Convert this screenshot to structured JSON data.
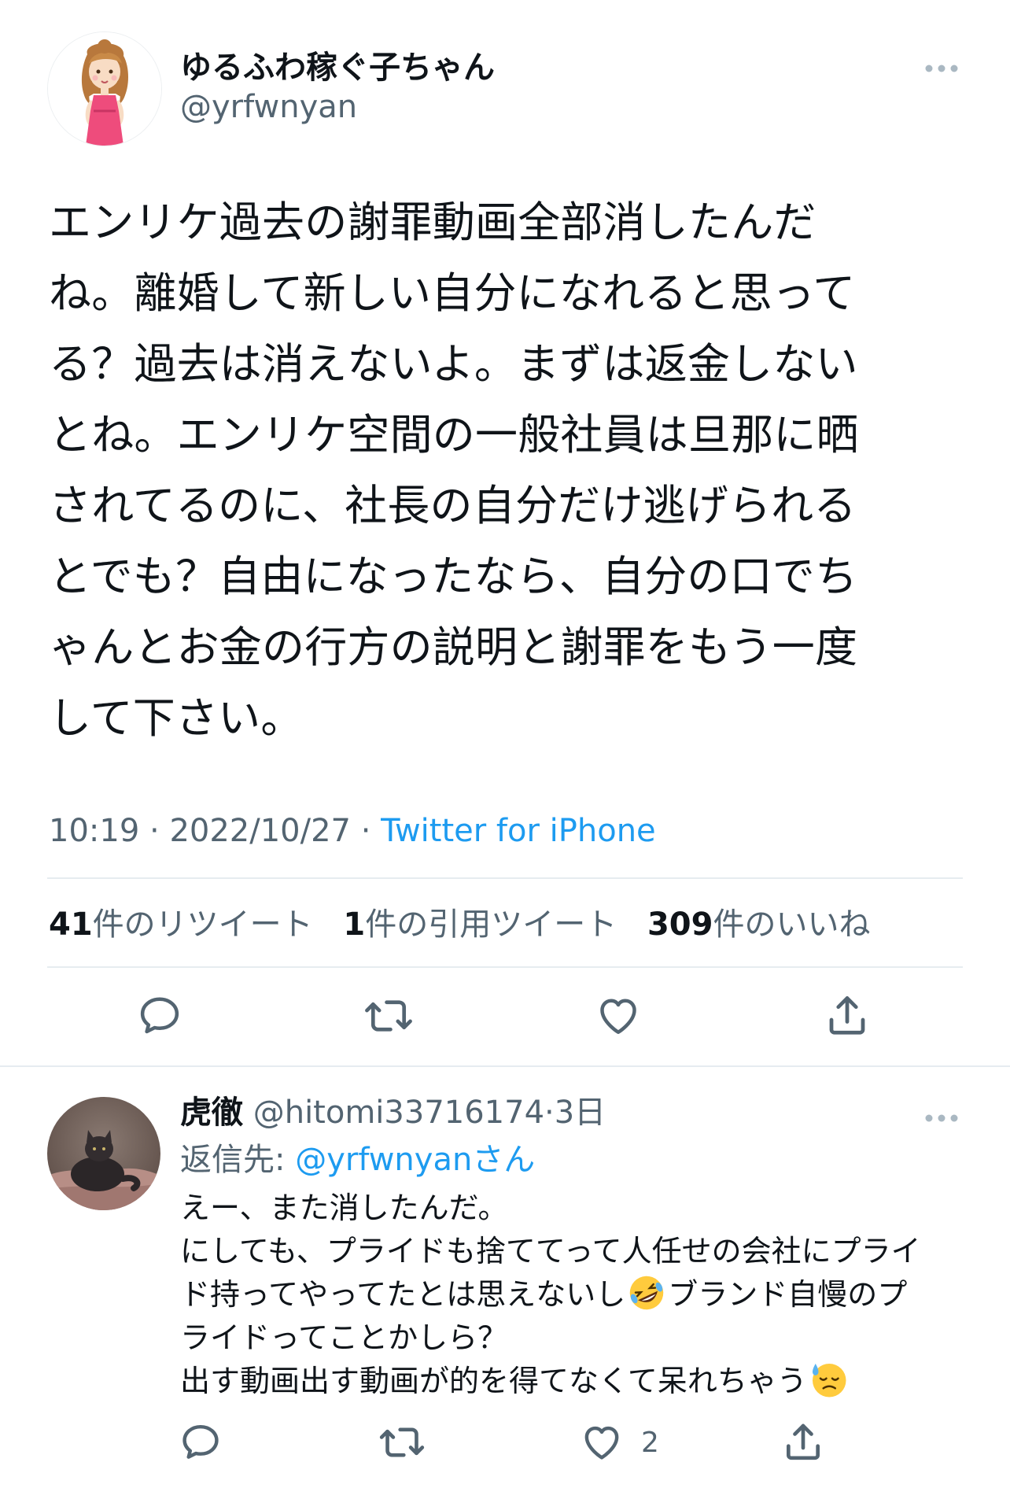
{
  "main_tweet": {
    "author": {
      "display_name": "ゆるふわ稼ぐ子ちゃん",
      "handle": "@yrfwnyan"
    },
    "text_lines": [
      "エンリケ過去の謝罪動画全部消したんだ",
      "ね。離婚して新しい自分になれると思って",
      "る？過去は消えないよ。まずは返金しない",
      "とね。エンリケ空間の一般社員は旦那に晒",
      "されてるのに、社長の自分だけ逃げられる",
      "とでも？自由になったなら、自分の口でち",
      "ゃんとお金の行方の説明と謝罪をもう一度",
      "して下さい。"
    ],
    "meta": {
      "time": "10:19",
      "date": "2022/10/27",
      "separator": "·",
      "source": "Twitter for iPhone"
    },
    "stats": {
      "retweets_count": "41",
      "retweets_label": "件のリツイート",
      "quotes_count": "1",
      "quotes_label": "件の引用ツイート",
      "likes_count": "309",
      "likes_label": "件のいいね"
    }
  },
  "reply": {
    "author": {
      "display_name": "虎徹",
      "handle": "@hitomi33716174",
      "age": "3日",
      "separator": "·"
    },
    "replying_to": {
      "label": "返信先:",
      "mention": "@yrfwnyan",
      "suffix": "さん"
    },
    "body": {
      "line1": "えー、また消したんだ。",
      "line2": "にしても、プライドも捨ててって人任せの会社にプライ",
      "line3_a": "ド持ってやってたとは思えないし",
      "line3_b": "ブランド自慢のプ",
      "line4": "ライドってことかしら？",
      "line5": "出す動画出す動画が的を得てなくて呆れちゃう"
    },
    "likes_count": "2"
  },
  "icons": {
    "reply": "comment-bubble-icon",
    "retweet": "retweet-icon",
    "like": "heart-icon",
    "share": "share-upload-icon",
    "more": "more-dots-icon"
  },
  "colors": {
    "text": "#0f1419",
    "secondary": "#536471",
    "link": "#1d9bf0",
    "divider": "#e6ecf0"
  }
}
